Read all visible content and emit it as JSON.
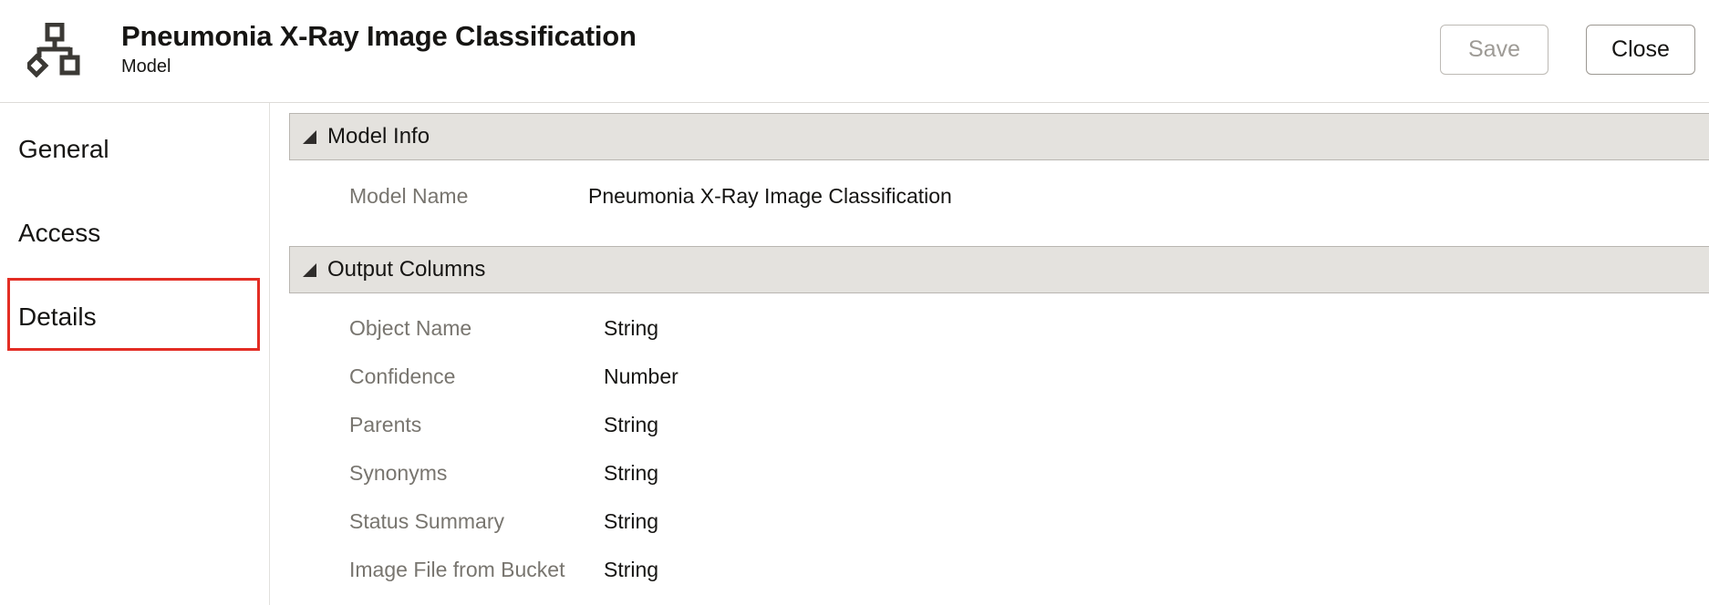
{
  "header": {
    "icon": "model-hierarchy-icon",
    "title": "Pneumonia X-Ray Image Classification",
    "subtitle": "Model",
    "save_label": "Save",
    "close_label": "Close"
  },
  "sidebar": {
    "items": [
      {
        "label": "General"
      },
      {
        "label": "Access"
      },
      {
        "label": "Details",
        "selected": true
      }
    ],
    "highlight_color": "#e32d24"
  },
  "model_info": {
    "section_title": "Model Info",
    "model_name_label": "Model Name",
    "model_name_value": "Pneumonia X-Ray Image Classification"
  },
  "output_columns": {
    "section_title": "Output Columns",
    "columns": [
      {
        "name": "Object Name",
        "type": "String"
      },
      {
        "name": "Confidence",
        "type": "Number"
      },
      {
        "name": "Parents",
        "type": "String"
      },
      {
        "name": "Synonyms",
        "type": "String"
      },
      {
        "name": "Status Summary",
        "type": "String"
      },
      {
        "name": "Image File from Bucket",
        "type": "String"
      }
    ]
  },
  "colors": {
    "section_header_bg": "#e4e2de",
    "label_text": "#78756f",
    "primary_text": "#161513"
  }
}
